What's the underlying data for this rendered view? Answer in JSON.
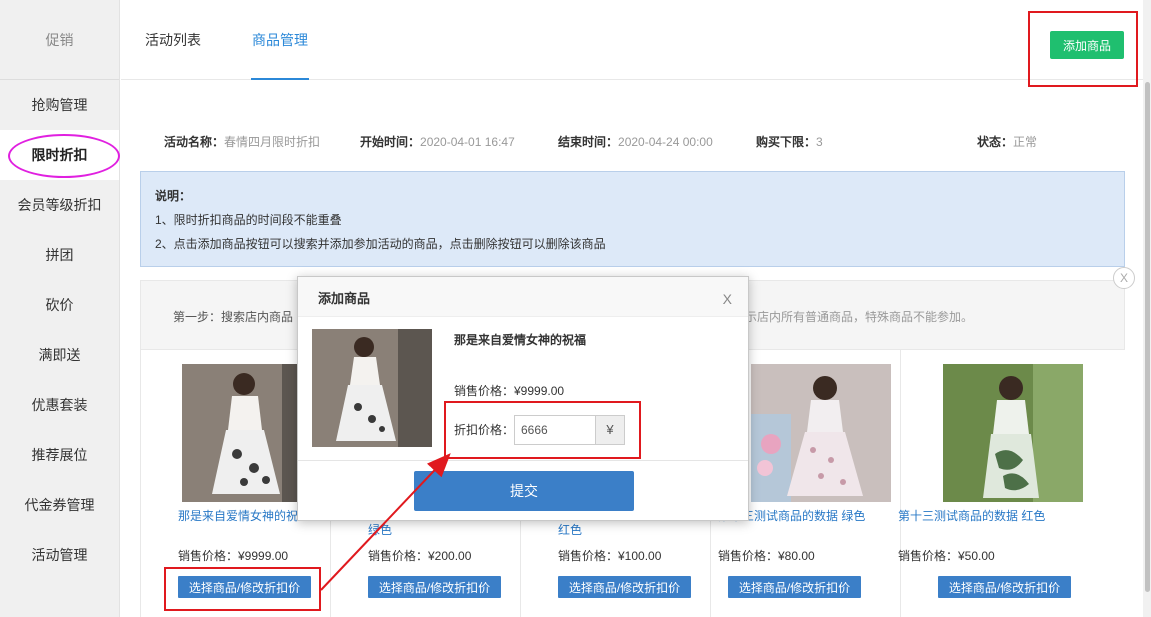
{
  "sidebar": {
    "header": "促销",
    "items": [
      {
        "label": "抢购管理"
      },
      {
        "label": "限时折扣"
      },
      {
        "label": "会员等级折扣"
      },
      {
        "label": "拼团"
      },
      {
        "label": "砍价"
      },
      {
        "label": "满即送"
      },
      {
        "label": "优惠套装"
      },
      {
        "label": "推荐展位"
      },
      {
        "label": "代金券管理"
      },
      {
        "label": "活动管理"
      }
    ],
    "active_index": 1
  },
  "tabs": [
    {
      "label": "活动列表"
    },
    {
      "label": "商品管理"
    }
  ],
  "add_button": "添加商品",
  "info": {
    "name_label": "活动名称：",
    "name_value": "春情四月限时折扣",
    "start_label": "开始时间：",
    "start_value": "2020-04-01 16:47",
    "end_label": "结束时间：",
    "end_value": "2020-04-24 00:00",
    "limit_label": "购买下限：",
    "limit_value": "3",
    "status_label": "状态：",
    "status_value": "正常"
  },
  "notice": {
    "title": "说明：",
    "lines": [
      "1、限时折扣商品的时间段不能重叠",
      "2、点击添加商品按钮可以搜索并添加参加活动的商品，点击删除按钮可以删除该商品"
    ]
  },
  "step": {
    "left": "第一步：搜索店内商品",
    "right": "示店内所有普通商品，特殊商品不能参加。"
  },
  "close_glyph": "X",
  "products": [
    {
      "name": "那是来自爱情女神的祝",
      "price": "销售价格：¥9999.00",
      "button": "选择商品/修改折扣价",
      "palette": [
        "#8a8077",
        "#efefef",
        "#3a3a3a"
      ]
    },
    {
      "name": "绿色",
      "price": "销售价格：¥200.00",
      "button": "选择商品/修改折扣价",
      "palette": [
        "#9aa58a",
        "#eee",
        "#555"
      ]
    },
    {
      "name": "红色",
      "price": "销售价格：¥100.00",
      "button": "选择商品/修改折扣价",
      "palette": [
        "#b49a96",
        "#eee",
        "#555"
      ]
    },
    {
      "name": "第十三测试商品的数据 绿色",
      "price": "销售价格：¥80.00",
      "button": "选择商品/修改折扣价",
      "palette": [
        "#b5a9a4",
        "#f2eef0",
        "#c79aa8"
      ]
    },
    {
      "name": "第十三测试商品的数据 红色",
      "price": "销售价格：¥50.00",
      "button": "选择商品/修改折扣价",
      "palette": [
        "#6c8a4a",
        "#dfe8dc",
        "#4d7048"
      ]
    }
  ],
  "modal": {
    "title": "添加商品",
    "close": "X",
    "product_name": "那是来自爱情女神的祝福",
    "price": "销售价格：¥9999.00",
    "discount_label": "折扣价格：",
    "discount_value": "6666",
    "currency": "¥",
    "submit": "提交"
  },
  "colors": {
    "accent": "#2b88d8",
    "green": "#1fbf6f",
    "button_blue": "#3b7fc8",
    "annotation_red": "#e0191e",
    "annotation_magenta": "#e020e0"
  }
}
